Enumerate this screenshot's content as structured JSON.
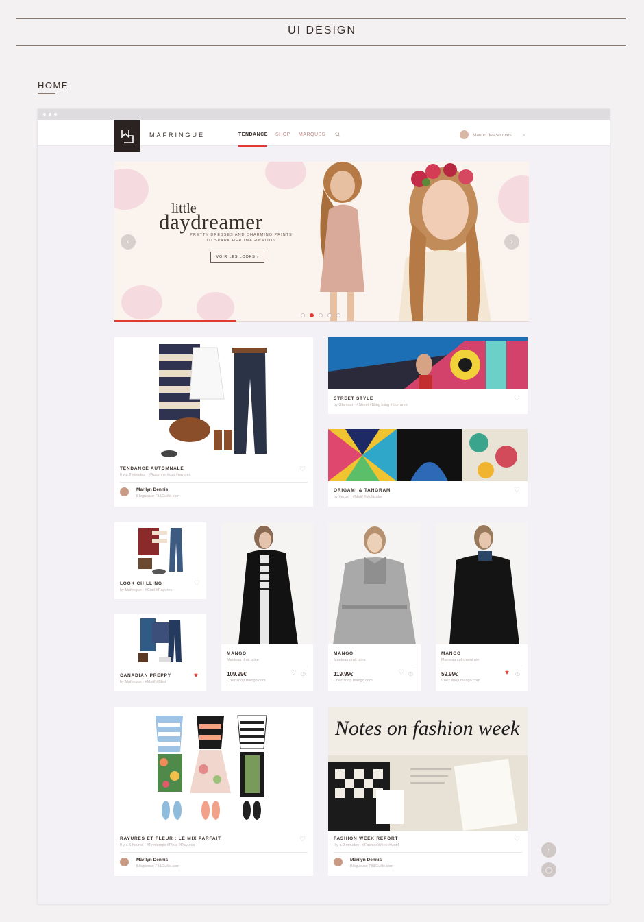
{
  "page": {
    "title": "UI DESIGN",
    "section": "HOME"
  },
  "colors": {
    "accent": "#e03a32",
    "logo_bg": "#2b2321",
    "text": "#3a2f2b"
  },
  "nav": {
    "brand": "MAFRINGUE",
    "logo_mark": "M",
    "items": [
      "TENDANCE",
      "SHOP",
      "MARQUES"
    ],
    "active": "TENDANCE",
    "user": "Manon des sources"
  },
  "hero": {
    "title_small": "little",
    "title_large": "daydreamer",
    "subtitle_line1": "PRETTY DRESSES AND CHARMING PRINTS",
    "subtitle_line2": "TO SPARK HER IMAGINATION",
    "button": "VOIR LES LOOKS",
    "active_slide": 2,
    "slide_count": 5
  },
  "cards": {
    "tendance": {
      "title": "TENDANCE AUTOMNALE",
      "meta": "Il y a 2 minutes · #Automne #cuir #rayures",
      "author": "Marilyn Dennis",
      "blog": "Blogueuse Fil&Guille.com"
    },
    "street": {
      "title": "STREET STYLE",
      "meta": "by Glamour · #Street #Bling bling #fourrures"
    },
    "origami": {
      "title": "ORIGAMI & TANGRAM",
      "meta": "by Kenzo · #Motif #Multicolor"
    },
    "chilling": {
      "title": "LOOK CHILLING",
      "meta": "by Mafringue · #Cool #Rayures"
    },
    "canadian": {
      "title": "CANADIAN PREPPY",
      "meta": "by Mafringue · #Motif #Bleu"
    },
    "mango1": {
      "title": "MANGO",
      "meta": "Manteau droit laine",
      "price": "109.99€",
      "shop": "Chez shop.mango.com"
    },
    "mango2": {
      "title": "MANGO",
      "meta": "Manteau droit laine",
      "price": "119.99€",
      "shop": "Chez shop.mango.com"
    },
    "mango3": {
      "title": "MANGO",
      "meta": "Manteau col cheminée",
      "price": "59.99€",
      "shop": "Chez shop.mango.com"
    },
    "rayures": {
      "title": "RAYURES ET FLEUR : LE MIX PARFAIT",
      "meta": "Il y a 5 heures · #Printemps #Fleur #Rayures",
      "author": "Marilyn Dennis",
      "blog": "Blogueuse Fil&Guille.com"
    },
    "fashion": {
      "title": "FASHION WEEK REPORT",
      "meta": "Il y a 2 minutes · #FashionWeek #Motif",
      "author": "Marilyn Dennis",
      "blog": "Blogueuse Fil&Guille.com",
      "handwriting": "Notes on fashion week"
    }
  }
}
